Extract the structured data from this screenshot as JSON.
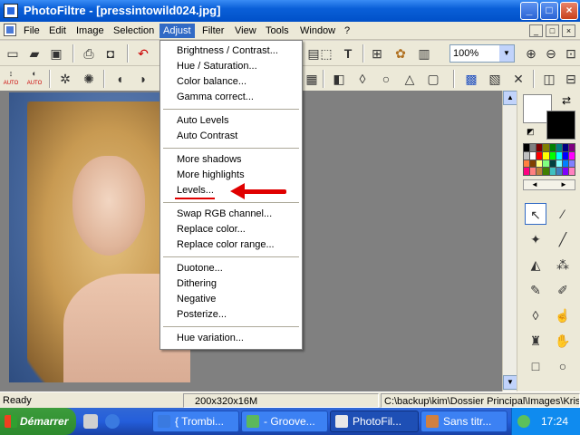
{
  "window": {
    "app_name": "PhotoFiltre",
    "title": "PhotoFiltre - [pressintowild024.jpg]",
    "min_glyph": "_",
    "max_glyph": "□",
    "close_glyph": "×"
  },
  "menubar": {
    "items": [
      "File",
      "Edit",
      "Image",
      "Selection",
      "Adjust",
      "Filter",
      "View",
      "Tools",
      "Window",
      "?"
    ],
    "active": "Adjust",
    "mdi_glyphs": [
      "_",
      "□",
      "×"
    ]
  },
  "toolbar": {
    "zoom_value": "100%",
    "zoom_arrow": "▼",
    "auto_labels": [
      "AUTO",
      "AUTO"
    ]
  },
  "adjust_menu": {
    "groups": [
      [
        "Brightness / Contrast...",
        "Hue / Saturation...",
        "Color balance...",
        "Gamma correct..."
      ],
      [
        "Auto Levels",
        "Auto Contrast"
      ],
      [
        "More shadows",
        "More highlights",
        "Levels..."
      ],
      [
        "Swap RGB channel...",
        "Replace color...",
        "Replace color range..."
      ],
      [
        "Duotone...",
        "Dithering",
        "Negative",
        "Posterize..."
      ],
      [
        "Hue variation..."
      ]
    ],
    "highlighted_item": "Levels..."
  },
  "palette": {
    "colors": [
      "#000000",
      "#808080",
      "#800000",
      "#808000",
      "#008000",
      "#008080",
      "#000080",
      "#800080",
      "#c0c0c0",
      "#ffffff",
      "#ff0000",
      "#ffff00",
      "#00ff00",
      "#00ffff",
      "#0000ff",
      "#ff00ff",
      "#ff8040",
      "#804000",
      "#ffff80",
      "#80ff80",
      "#004040",
      "#80ffff",
      "#0080ff",
      "#8080ff",
      "#ff0080",
      "#ff8080",
      "#c08040",
      "#408000",
      "#40c0c0",
      "#4080c0",
      "#8000ff",
      "#ff80c0"
    ],
    "foreground_color": "#ffffff",
    "background_color": "#000000",
    "nav_left": "◄",
    "nav_right": "►"
  },
  "statusbar": {
    "status": "Ready",
    "dimensions": "200x320x16M",
    "path": "C:\\backup\\kim\\Dossier Principal\\Images\\Kriste"
  },
  "taskbar": {
    "start_label": "Démarrer",
    "tasks": [
      "{ Trombi...",
      "- Groove...",
      "PhotoFil...",
      "Sans titr..."
    ],
    "active_task": "PhotoFil...",
    "clock": "17:24"
  },
  "colors": {
    "annotation": "#e00000",
    "menu_highlight": "#316ac5",
    "title_blue": "#0a5fd8"
  }
}
